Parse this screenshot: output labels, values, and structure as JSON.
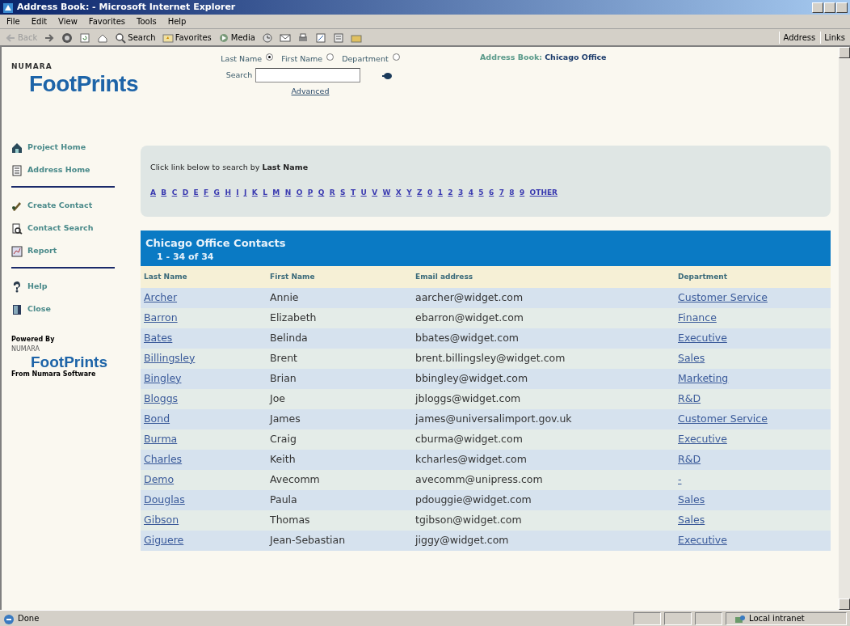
{
  "window": {
    "title": "Address Book: - Microsoft Internet Explorer"
  },
  "menu": [
    "File",
    "Edit",
    "View",
    "Favorites",
    "Tools",
    "Help"
  ],
  "toolbar": {
    "back": "Back",
    "search": "Search",
    "favorites": "Favorites",
    "media": "Media",
    "address": "Address",
    "links": "Links"
  },
  "logo": {
    "brand": "NUMARA",
    "product": "FootPrints"
  },
  "search": {
    "options": [
      {
        "label": "Last Name",
        "selected": true
      },
      {
        "label": "First Name",
        "selected": false
      },
      {
        "label": "Department",
        "selected": false
      }
    ],
    "label": "Search",
    "advanced": "Advanced"
  },
  "address_book": {
    "label": "Address Book:",
    "value": "Chicago Office"
  },
  "sidebar": {
    "sections": [
      {
        "items": [
          "Project Home",
          "Address Home"
        ]
      },
      {
        "items": [
          "Create Contact",
          "Contact Search",
          "Report"
        ]
      },
      {
        "items": [
          "Help",
          "Close"
        ]
      }
    ],
    "powered_by": {
      "label": "Powered By",
      "brand": "NUMARA",
      "product": "FootPrints",
      "maker": "From Numara Software"
    }
  },
  "alpha_search": {
    "instruction": "Click link below to search by **Last Name**",
    "links": [
      "A",
      "B",
      "C",
      "D",
      "E",
      "F",
      "G",
      "H",
      "I",
      "J",
      "K",
      "L",
      "M",
      "N",
      "O",
      "P",
      "Q",
      "R",
      "S",
      "T",
      "U",
      "V",
      "W",
      "X",
      "Y",
      "Z",
      "0",
      "1",
      "2",
      "3",
      "4",
      "5",
      "6",
      "7",
      "8",
      "9",
      "OTHER"
    ]
  },
  "table": {
    "title": "Chicago Office Contacts",
    "range": "1 - 34 of 34",
    "columns": [
      "Last Name",
      "First Name",
      "Email address",
      "Department"
    ],
    "rows": [
      {
        "last_name": "Archer",
        "first_name": "Annie",
        "email": "aarcher@widget.com",
        "department": "Customer Service"
      },
      {
        "last_name": "Barron",
        "first_name": "Elizabeth",
        "email": "ebarron@widget.com",
        "department": "Finance"
      },
      {
        "last_name": "Bates",
        "first_name": "Belinda",
        "email": "bbates@widget.com",
        "department": "Executive"
      },
      {
        "last_name": "Billingsley",
        "first_name": "Brent",
        "email": "brent.billingsley@widget.com",
        "department": "Sales"
      },
      {
        "last_name": "Bingley",
        "first_name": "Brian",
        "email": "bbingley@widget.com",
        "department": "Marketing"
      },
      {
        "last_name": "Bloggs",
        "first_name": "Joe",
        "email": "jbloggs@widget.com",
        "department": "R&D"
      },
      {
        "last_name": "Bond",
        "first_name": "James",
        "email": "james@universalimport.gov.uk",
        "department": "Customer Service"
      },
      {
        "last_name": "Burma",
        "first_name": "Craig",
        "email": "cburma@widget.com",
        "department": "Executive"
      },
      {
        "last_name": "Charles",
        "first_name": "Keith",
        "email": "kcharles@widget.com",
        "department": "R&D"
      },
      {
        "last_name": "Demo",
        "first_name": "Avecomm",
        "email": "avecomm@unipress.com",
        "department": "-"
      },
      {
        "last_name": "Douglas",
        "first_name": "Paula",
        "email": "pdouggie@widget.com",
        "department": "Sales"
      },
      {
        "last_name": "Gibson",
        "first_name": "Thomas",
        "email": "tgibson@widget.com",
        "department": "Sales"
      },
      {
        "last_name": "Giguere",
        "first_name": "Jean-Sebastian",
        "email": "jiggy@widget.com",
        "department": "Executive"
      }
    ]
  },
  "status_bar": {
    "status": "Done",
    "zone": "Local intranet"
  }
}
